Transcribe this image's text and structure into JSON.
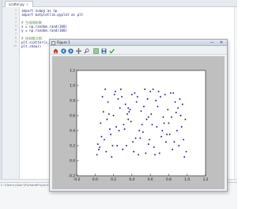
{
  "editor": {
    "tab_label": "scatter.py",
    "tab_close": "×",
    "lines": [
      {
        "n": "1",
        "text": "import numpy as np",
        "kind": "code"
      },
      {
        "n": "2",
        "text": "import matplotlib.pyplot as plt",
        "kind": "code"
      },
      {
        "n": "3",
        "text": "",
        "kind": "code"
      },
      {
        "n": "4",
        "text": "# 生成随机数",
        "kind": "comment"
      },
      {
        "n": "5",
        "text": "x = np.random.rand(100)",
        "kind": "code"
      },
      {
        "n": "6",
        "text": "y = np.random.rand(100)",
        "kind": "code"
      },
      {
        "n": "7",
        "text": "",
        "kind": "code"
      },
      {
        "n": "8",
        "text": "# 绘制散点图",
        "kind": "comment"
      },
      {
        "n": "9",
        "text": "plt.scatter(x, y",
        "kind": "code"
      },
      {
        "n": "10",
        "text": "plt.show()",
        "kind": "code"
      }
    ],
    "status_path": "C:\\Users\\User\\PycharmProjects\\..."
  },
  "figure_window": {
    "title": "Figure 1",
    "minimize": "—",
    "close": "✕",
    "toolbar": [
      {
        "name": "home-icon",
        "color": "#c0392b"
      },
      {
        "name": "back-arrow-icon",
        "color": "#1f6fb2"
      },
      {
        "name": "forward-arrow-icon",
        "color": "#1f6fb2"
      },
      {
        "name": "pan-icon",
        "color": "#333333"
      },
      {
        "name": "zoom-icon",
        "color": "#333333"
      },
      {
        "name": "subplots-icon",
        "color": "#2e7d32"
      },
      {
        "name": "save-icon",
        "color": "#1f4e8a"
      },
      {
        "name": "edit-check-icon",
        "color": "#2e9e2e"
      }
    ]
  },
  "chart_data": {
    "type": "scatter",
    "xlim": [
      -0.2,
      1.2
    ],
    "ylim": [
      -0.2,
      1.2
    ],
    "x_ticks": [
      "-0.2",
      "0.0",
      "0.2",
      "0.4",
      "0.6",
      "0.8",
      "1.0",
      "1.2"
    ],
    "y_ticks": [
      "-0.2",
      "0.0",
      "0.2",
      "0.4",
      "0.6",
      "0.8",
      "1.0",
      "1.2"
    ],
    "marker_color": "#1c1c8a",
    "x": [
      0.05,
      0.08,
      0.12,
      0.15,
      0.18,
      0.22,
      0.26,
      0.3,
      0.33,
      0.36,
      0.4,
      0.44,
      0.47,
      0.5,
      0.54,
      0.58,
      0.62,
      0.66,
      0.7,
      0.74,
      0.78,
      0.82,
      0.86,
      0.9,
      0.94,
      0.97,
      0.06,
      0.1,
      0.14,
      0.2,
      0.24,
      0.28,
      0.32,
      0.38,
      0.42,
      0.46,
      0.52,
      0.56,
      0.6,
      0.64,
      0.68,
      0.72,
      0.76,
      0.8,
      0.84,
      0.88,
      0.92,
      0.96,
      0.03,
      0.09,
      0.16,
      0.21,
      0.27,
      0.34,
      0.39,
      0.45,
      0.49,
      0.55,
      0.61,
      0.67,
      0.71,
      0.77,
      0.83,
      0.89,
      0.95,
      0.99,
      0.07,
      0.13,
      0.19,
      0.25,
      0.31,
      0.37,
      0.43,
      0.48,
      0.53,
      0.59,
      0.65,
      0.69,
      0.75,
      0.81,
      0.87,
      0.93,
      0.04,
      0.11,
      0.17,
      0.23,
      0.29,
      0.35,
      0.41,
      0.51,
      0.57,
      0.63,
      0.73,
      0.79,
      0.85,
      0.91,
      0.98,
      0.02,
      0.58,
      0.36
    ],
    "y": [
      0.18,
      0.85,
      0.12,
      0.62,
      0.05,
      0.92,
      0.4,
      0.15,
      0.75,
      0.55,
      0.88,
      0.3,
      0.08,
      0.66,
      0.95,
      0.22,
      0.48,
      0.8,
      0.1,
      0.58,
      0.35,
      0.9,
      0.25,
      0.7,
      0.45,
      0.05,
      0.5,
      0.28,
      0.78,
      0.6,
      0.2,
      0.95,
      0.42,
      0.68,
      0.12,
      0.85,
      0.38,
      0.55,
      0.92,
      0.18,
      0.72,
      0.32,
      0.88,
      0.5,
      0.15,
      0.64,
      0.82,
      0.28,
      0.22,
      0.65,
      0.42,
      0.88,
      0.7,
      0.2,
      0.52,
      0.78,
      0.3,
      0.1,
      0.62,
      0.45,
      0.85,
      0.25,
      0.58,
      0.4,
      0.75,
      0.12,
      0.32,
      0.55,
      0.2,
      0.82,
      0.48,
      0.65,
      0.9,
      0.4,
      0.72,
      0.28,
      0.08,
      0.92,
      0.5,
      0.35,
      0.78,
      0.6,
      0.15,
      0.95,
      0.35,
      0.45,
      0.85,
      0.62,
      0.25,
      0.48,
      0.82,
      0.95,
      0.4,
      0.68,
      0.9,
      0.2,
      0.55,
      0.08,
      0.58,
      0.7
    ]
  }
}
